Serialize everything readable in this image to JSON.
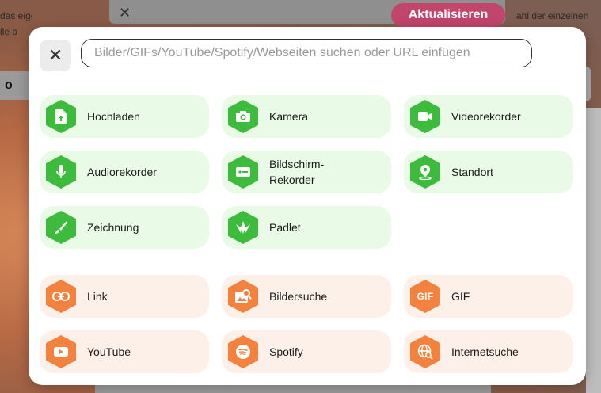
{
  "background": {
    "update_button": "Aktualisieren",
    "left_text": "das eigene Prakti\nlle b",
    "right_text": "ahl der einzelnen\nbilic",
    "left_strip": "o"
  },
  "search": {
    "placeholder": "Bilder/GIFs/YouTube/Spotify/Webseiten suchen oder URL einfügen"
  },
  "create_options": [
    {
      "label": "Hochladen",
      "icon": "upload-file-icon"
    },
    {
      "label": "Kamera",
      "icon": "camera-icon"
    },
    {
      "label": "Videorekorder",
      "icon": "video-camera-icon"
    },
    {
      "label": "Audiorekorder",
      "icon": "microphone-icon"
    },
    {
      "label": "Bildschirm-\nRekorder",
      "icon": "screen-recorder-icon"
    },
    {
      "label": "Standort",
      "icon": "location-pin-icon"
    },
    {
      "label": "Zeichnung",
      "icon": "brush-icon"
    },
    {
      "label": "Padlet",
      "icon": "padlet-icon"
    }
  ],
  "search_options": [
    {
      "label": "Link",
      "icon": "link-icon"
    },
    {
      "label": "Bildersuche",
      "icon": "image-search-icon"
    },
    {
      "label": "GIF",
      "icon": "gif-icon",
      "icon_text": "GIF"
    },
    {
      "label": "YouTube",
      "icon": "youtube-icon"
    },
    {
      "label": "Spotify",
      "icon": "spotify-icon"
    },
    {
      "label": "Internetsuche",
      "icon": "web-search-icon"
    }
  ],
  "colors": {
    "green_tile": "#e9fae6",
    "green_icon": "#3dbb3d",
    "orange_tile": "#fdf0e8",
    "orange_icon": "#f3823f",
    "update_button": "#c2456b"
  }
}
